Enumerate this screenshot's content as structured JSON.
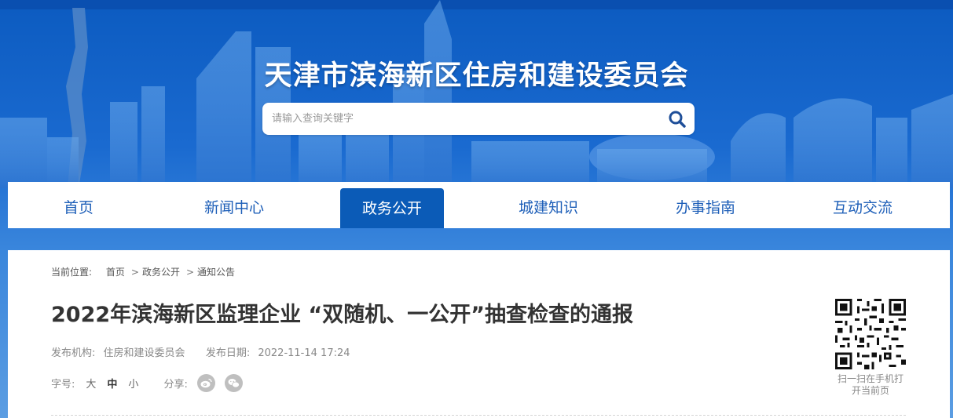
{
  "header": {
    "site_title": "天津市滨海新区住房和建设委员会",
    "search_placeholder": "请输入查询关键字"
  },
  "nav": {
    "items": [
      {
        "label": "首页",
        "active": false
      },
      {
        "label": "新闻中心",
        "active": false
      },
      {
        "label": "政务公开",
        "active": true
      },
      {
        "label": "城建知识",
        "active": false
      },
      {
        "label": "办事指南",
        "active": false
      },
      {
        "label": "互动交流",
        "active": false
      }
    ]
  },
  "breadcrumb": {
    "prefix": "当前位置:",
    "items": [
      "首页",
      "政务公开",
      "通知公告"
    ]
  },
  "article": {
    "title": "2022年滨海新区监理企业 “双随机、一公开”抽查检查的通报",
    "publisher_label": "发布机构:",
    "publisher": "住房和建设委员会",
    "date_label": "发布日期:",
    "date": "2022-11-14 17:24",
    "font_size_label": "字号:",
    "font_sizes": [
      "大",
      "中",
      "小"
    ],
    "font_size_active": "中",
    "share_label": "分享:",
    "share_icons": [
      "weibo-icon",
      "wechat-icon"
    ]
  },
  "qr": {
    "caption_line1": "扫一扫在手机打",
    "caption_line2": "开当前页"
  },
  "colors": {
    "brand_blue": "#0b5bb7",
    "nav_text": "#1e5fb8",
    "title_text": "#333333"
  }
}
